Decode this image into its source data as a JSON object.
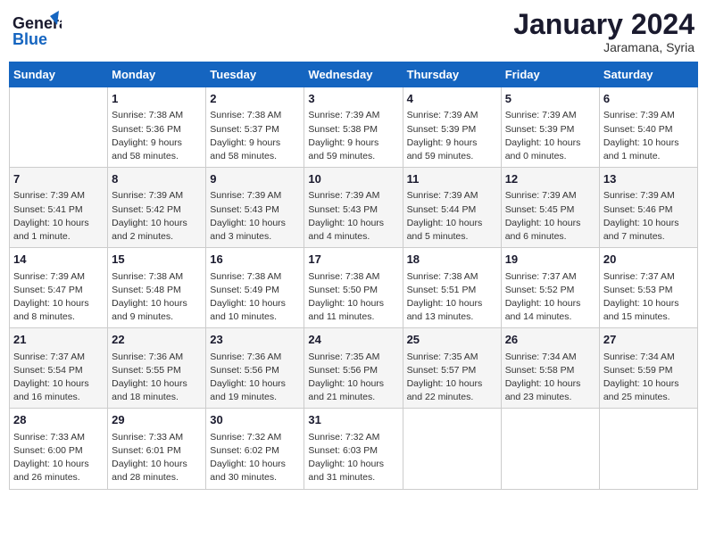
{
  "header": {
    "logo_line1": "General",
    "logo_line2": "Blue",
    "month": "January 2024",
    "location": "Jaramana, Syria"
  },
  "weekdays": [
    "Sunday",
    "Monday",
    "Tuesday",
    "Wednesday",
    "Thursday",
    "Friday",
    "Saturday"
  ],
  "weeks": [
    [
      {
        "day": "",
        "info": ""
      },
      {
        "day": "1",
        "info": "Sunrise: 7:38 AM\nSunset: 5:36 PM\nDaylight: 9 hours\nand 58 minutes."
      },
      {
        "day": "2",
        "info": "Sunrise: 7:38 AM\nSunset: 5:37 PM\nDaylight: 9 hours\nand 58 minutes."
      },
      {
        "day": "3",
        "info": "Sunrise: 7:39 AM\nSunset: 5:38 PM\nDaylight: 9 hours\nand 59 minutes."
      },
      {
        "day": "4",
        "info": "Sunrise: 7:39 AM\nSunset: 5:39 PM\nDaylight: 9 hours\nand 59 minutes."
      },
      {
        "day": "5",
        "info": "Sunrise: 7:39 AM\nSunset: 5:39 PM\nDaylight: 10 hours\nand 0 minutes."
      },
      {
        "day": "6",
        "info": "Sunrise: 7:39 AM\nSunset: 5:40 PM\nDaylight: 10 hours\nand 1 minute."
      }
    ],
    [
      {
        "day": "7",
        "info": "Sunrise: 7:39 AM\nSunset: 5:41 PM\nDaylight: 10 hours\nand 1 minute."
      },
      {
        "day": "8",
        "info": "Sunrise: 7:39 AM\nSunset: 5:42 PM\nDaylight: 10 hours\nand 2 minutes."
      },
      {
        "day": "9",
        "info": "Sunrise: 7:39 AM\nSunset: 5:43 PM\nDaylight: 10 hours\nand 3 minutes."
      },
      {
        "day": "10",
        "info": "Sunrise: 7:39 AM\nSunset: 5:43 PM\nDaylight: 10 hours\nand 4 minutes."
      },
      {
        "day": "11",
        "info": "Sunrise: 7:39 AM\nSunset: 5:44 PM\nDaylight: 10 hours\nand 5 minutes."
      },
      {
        "day": "12",
        "info": "Sunrise: 7:39 AM\nSunset: 5:45 PM\nDaylight: 10 hours\nand 6 minutes."
      },
      {
        "day": "13",
        "info": "Sunrise: 7:39 AM\nSunset: 5:46 PM\nDaylight: 10 hours\nand 7 minutes."
      }
    ],
    [
      {
        "day": "14",
        "info": "Sunrise: 7:39 AM\nSunset: 5:47 PM\nDaylight: 10 hours\nand 8 minutes."
      },
      {
        "day": "15",
        "info": "Sunrise: 7:38 AM\nSunset: 5:48 PM\nDaylight: 10 hours\nand 9 minutes."
      },
      {
        "day": "16",
        "info": "Sunrise: 7:38 AM\nSunset: 5:49 PM\nDaylight: 10 hours\nand 10 minutes."
      },
      {
        "day": "17",
        "info": "Sunrise: 7:38 AM\nSunset: 5:50 PM\nDaylight: 10 hours\nand 11 minutes."
      },
      {
        "day": "18",
        "info": "Sunrise: 7:38 AM\nSunset: 5:51 PM\nDaylight: 10 hours\nand 13 minutes."
      },
      {
        "day": "19",
        "info": "Sunrise: 7:37 AM\nSunset: 5:52 PM\nDaylight: 10 hours\nand 14 minutes."
      },
      {
        "day": "20",
        "info": "Sunrise: 7:37 AM\nSunset: 5:53 PM\nDaylight: 10 hours\nand 15 minutes."
      }
    ],
    [
      {
        "day": "21",
        "info": "Sunrise: 7:37 AM\nSunset: 5:54 PM\nDaylight: 10 hours\nand 16 minutes."
      },
      {
        "day": "22",
        "info": "Sunrise: 7:36 AM\nSunset: 5:55 PM\nDaylight: 10 hours\nand 18 minutes."
      },
      {
        "day": "23",
        "info": "Sunrise: 7:36 AM\nSunset: 5:56 PM\nDaylight: 10 hours\nand 19 minutes."
      },
      {
        "day": "24",
        "info": "Sunrise: 7:35 AM\nSunset: 5:56 PM\nDaylight: 10 hours\nand 21 minutes."
      },
      {
        "day": "25",
        "info": "Sunrise: 7:35 AM\nSunset: 5:57 PM\nDaylight: 10 hours\nand 22 minutes."
      },
      {
        "day": "26",
        "info": "Sunrise: 7:34 AM\nSunset: 5:58 PM\nDaylight: 10 hours\nand 23 minutes."
      },
      {
        "day": "27",
        "info": "Sunrise: 7:34 AM\nSunset: 5:59 PM\nDaylight: 10 hours\nand 25 minutes."
      }
    ],
    [
      {
        "day": "28",
        "info": "Sunrise: 7:33 AM\nSunset: 6:00 PM\nDaylight: 10 hours\nand 26 minutes."
      },
      {
        "day": "29",
        "info": "Sunrise: 7:33 AM\nSunset: 6:01 PM\nDaylight: 10 hours\nand 28 minutes."
      },
      {
        "day": "30",
        "info": "Sunrise: 7:32 AM\nSunset: 6:02 PM\nDaylight: 10 hours\nand 30 minutes."
      },
      {
        "day": "31",
        "info": "Sunrise: 7:32 AM\nSunset: 6:03 PM\nDaylight: 10 hours\nand 31 minutes."
      },
      {
        "day": "",
        "info": ""
      },
      {
        "day": "",
        "info": ""
      },
      {
        "day": "",
        "info": ""
      }
    ]
  ]
}
